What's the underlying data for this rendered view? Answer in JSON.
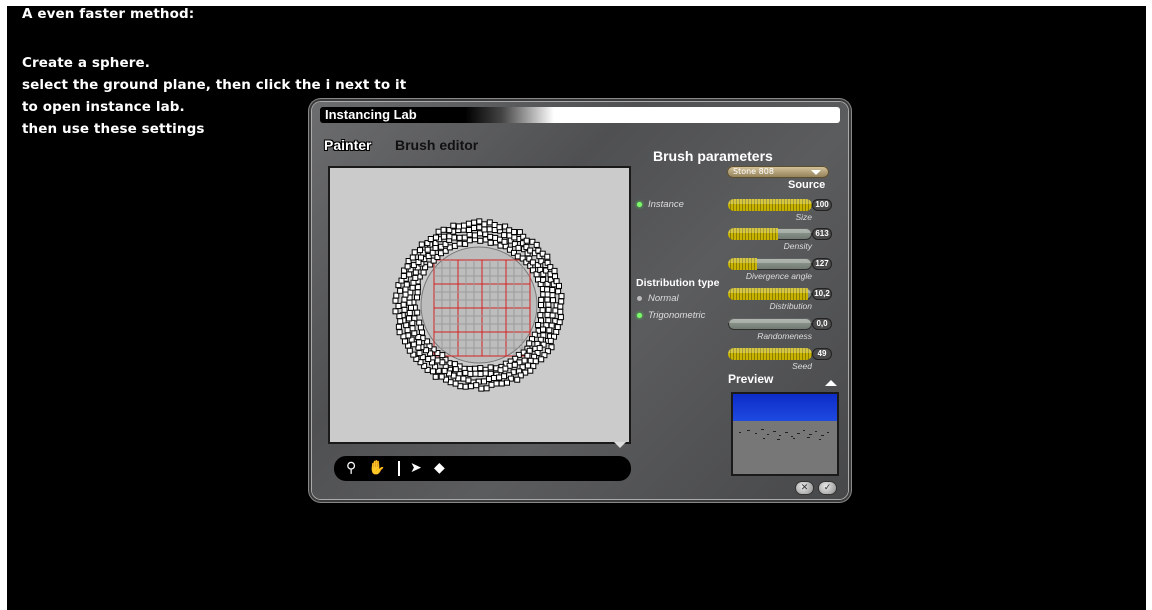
{
  "tutorial_text": {
    "heading": "A even faster method:",
    "step1": "Create a sphere.",
    "step2": "select the ground plane, then click the i next to it",
    "step3": "to open instance lab.",
    "step4": "then use these settings"
  },
  "window": {
    "title": "Instancing Lab"
  },
  "tabs": {
    "painter": "Painter",
    "brush_editor": "Brush editor"
  },
  "toolbar": {
    "icons": [
      "zoom-icon",
      "hand-icon",
      "brush-icon",
      "eraser-icon"
    ]
  },
  "brush_parameters": {
    "title": "Brush parameters",
    "source": {
      "value": "Stone 808",
      "label": "Source"
    },
    "instance_option": {
      "label": "Instance",
      "selected": true
    },
    "distribution_type": {
      "title": "Distribution type",
      "options": [
        {
          "label": "Normal",
          "selected": false
        },
        {
          "label": "Trigonometric",
          "selected": true
        }
      ]
    },
    "sliders": [
      {
        "label": "Size",
        "value": "100",
        "fill": 1.0
      },
      {
        "label": "Density",
        "value": "613",
        "fill": 0.6
      },
      {
        "label": "Divergence angle",
        "value": "127",
        "fill": 0.35
      },
      {
        "label": "Distribution",
        "value": "10,2",
        "fill": 0.95
      },
      {
        "label": "Randomeness",
        "value": "0,0",
        "fill": 0.0
      },
      {
        "label": "Seed",
        "value": "49",
        "fill": 1.0
      }
    ]
  },
  "preview": {
    "title": "Preview"
  },
  "buttons": {
    "close_icon": "close-icon",
    "ok_icon": "check-icon"
  },
  "colors": {
    "window_bg": "#5a5b5d",
    "accent_green": "#7cff6a",
    "slider_gold": "#c8b400",
    "preview_sky": "#1e4ae0",
    "grid_red": "#d22222"
  }
}
